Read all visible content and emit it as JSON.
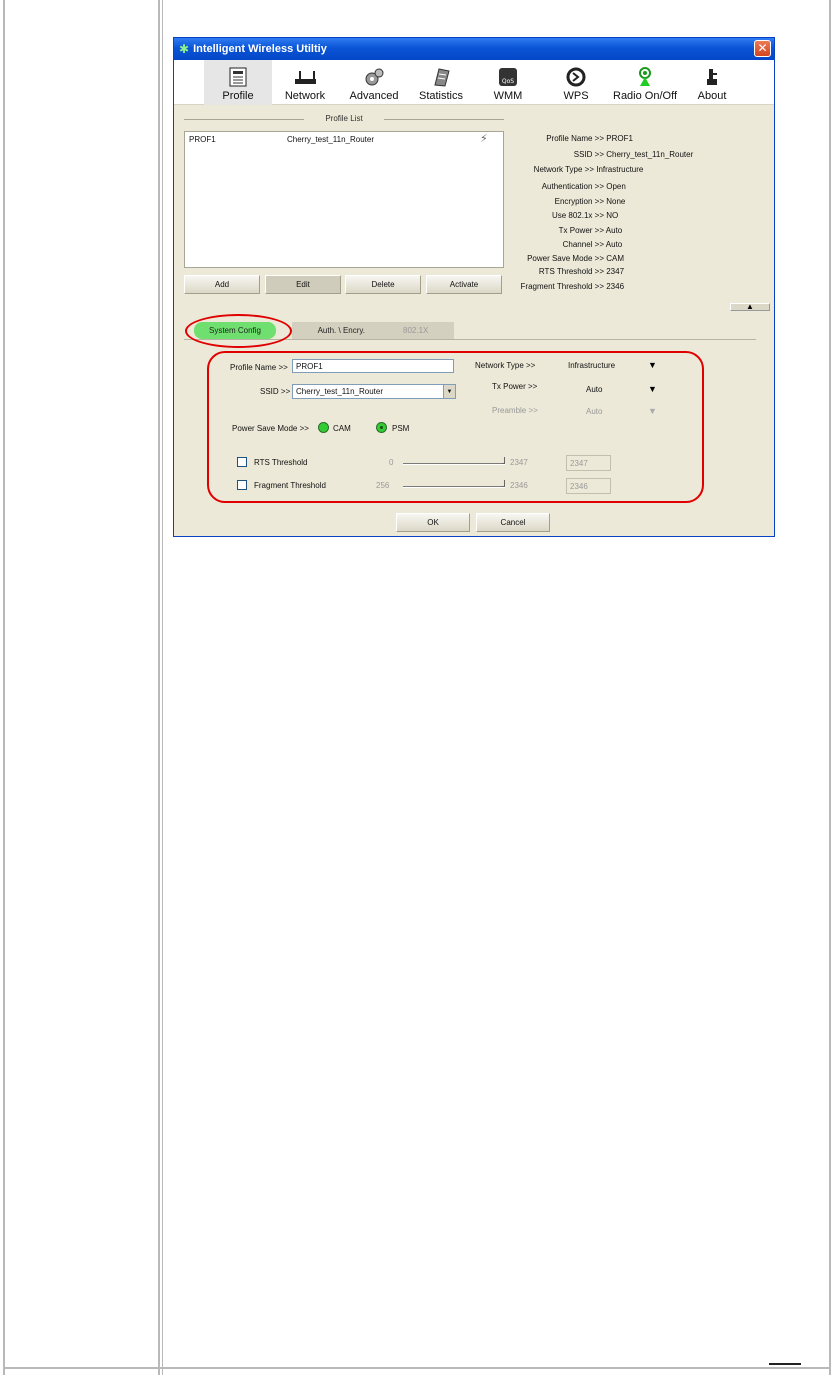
{
  "window": {
    "title": "Intelligent Wireless Utiltiy",
    "close_glyph": "✕"
  },
  "toolbar": {
    "items": [
      {
        "label": "Profile",
        "icon": "profile-icon"
      },
      {
        "label": "Network",
        "icon": "network-icon"
      },
      {
        "label": "Advanced",
        "icon": "advanced-icon"
      },
      {
        "label": "Statistics",
        "icon": "statistics-icon"
      },
      {
        "label": "WMM",
        "icon": "wmm-icon"
      },
      {
        "label": "WPS",
        "icon": "wps-icon"
      },
      {
        "label": "Radio On/Off",
        "icon": "radio-icon"
      },
      {
        "label": "About",
        "icon": "about-icon"
      }
    ]
  },
  "profile_list": {
    "title": "Profile List",
    "rows": [
      {
        "name": "PROF1",
        "ssid": "Cherry_test_11n_Router"
      }
    ],
    "buttons": {
      "add": "Add",
      "edit": "Edit",
      "delete": "Delete",
      "activate": "Activate"
    }
  },
  "details": [
    {
      "label": "Profile Name >>",
      "value": "PROF1"
    },
    {
      "label": "SSID >>",
      "value": "Cherry_test_11n_Router"
    },
    {
      "label": "Network Type >>",
      "value": "Infrastructure"
    },
    {
      "label": "Authentication >>",
      "value": "Open"
    },
    {
      "label": "Encryption >>",
      "value": "None"
    },
    {
      "label": "Use 802.1x >>",
      "value": "NO"
    },
    {
      "label": "Tx Power >>",
      "value": "Auto"
    },
    {
      "label": "Channel >>",
      "value": "Auto"
    },
    {
      "label": "Power Save Mode >>",
      "value": "CAM"
    },
    {
      "label": "RTS Threshold >>",
      "value": "2347"
    },
    {
      "label": "Fragment Threshold >>",
      "value": "2346"
    }
  ],
  "collapse_glyph": "▲",
  "tabs": {
    "system_config": "System Config",
    "auth": "Auth. \\ Encry.",
    "dot1x": "802.1X"
  },
  "form": {
    "profile_name_label": "Profile Name >>",
    "profile_name_value": "PROF1",
    "ssid_label": "SSID >>",
    "ssid_value": "Cherry_test_11n_Router",
    "network_type_label": "Network Type >>",
    "network_type_value": "Infrastructure",
    "tx_power_label": "Tx Power >>",
    "tx_power_value": "Auto",
    "preamble_label": "Preamble >>",
    "preamble_value": "Auto",
    "power_save_label": "Power Save Mode >>",
    "cam_label": "CAM",
    "psm_label": "PSM",
    "power_save_selected": "PSM",
    "rts_label": "RTS Threshold",
    "rts_min": "0",
    "rts_max": "2347",
    "rts_value": "2347",
    "frag_label": "Fragment Threshold",
    "frag_min": "256",
    "frag_max": "2346",
    "frag_value": "2346"
  },
  "footer": {
    "ok": "OK",
    "cancel": "Cancel"
  }
}
